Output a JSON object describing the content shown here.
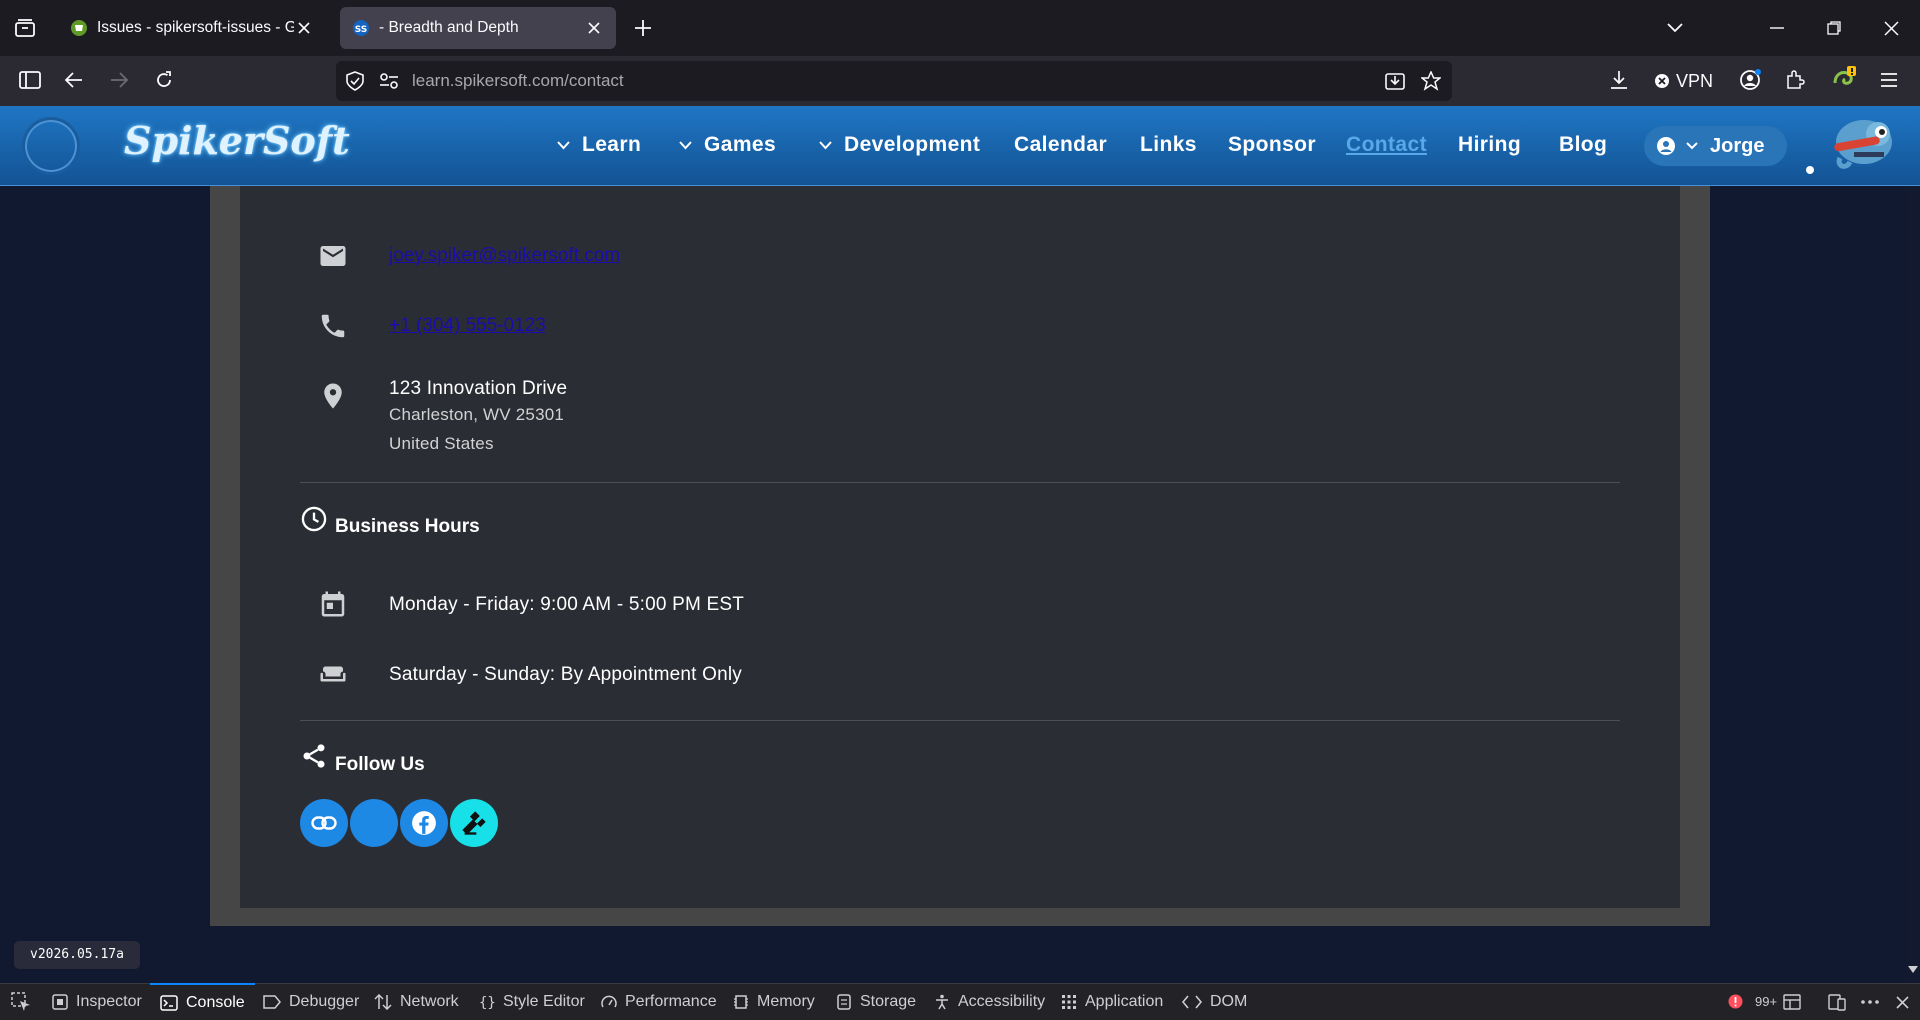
{
  "browser": {
    "tabs": [
      {
        "title": "Issues - spikersoft-issues - Gitea",
        "active": false
      },
      {
        "title": "- Breadth and Depth",
        "active": true
      }
    ],
    "url_domain": "learn.spikersoft.com",
    "url_path": "/contact",
    "vpn_label": "VPN"
  },
  "site": {
    "brand": "SpikerSoft",
    "nav": [
      {
        "label": "Learn",
        "dropdown": true
      },
      {
        "label": "Games",
        "dropdown": true
      },
      {
        "label": "Development",
        "dropdown": true
      },
      {
        "label": "Calendar",
        "dropdown": false
      },
      {
        "label": "Links",
        "dropdown": false
      },
      {
        "label": "Sponsor",
        "dropdown": false
      },
      {
        "label": "Contact",
        "dropdown": false,
        "current": true
      },
      {
        "label": "Hiring",
        "dropdown": false
      },
      {
        "label": "Blog",
        "dropdown": false
      }
    ],
    "user": "Jorge"
  },
  "contact": {
    "email": "joey.spiker@spikersoft.com",
    "phone": "+1 (304) 555-0123",
    "address_line1": "123 Innovation Drive",
    "address_line2": "Charleston, WV 25301",
    "address_line3": "United States"
  },
  "hours": {
    "title": "Business Hours",
    "weekday": "Monday - Friday: 9:00 AM - 5:00 PM EST",
    "weekend": "Saturday - Sunday: By Appointment Only"
  },
  "follow": {
    "title": "Follow Us",
    "buttons": [
      {
        "icon": "link-icon",
        "color": "#1e88e5"
      },
      {
        "icon": "blank-icon",
        "color": "#1e88e5"
      },
      {
        "icon": "facebook-icon",
        "color": "#1e88e5"
      },
      {
        "icon": "gavel-icon",
        "color": "#18e0e8"
      }
    ]
  },
  "version": "v2026.05.17a",
  "devtools": {
    "tabs": [
      "Inspector",
      "Console",
      "Debugger",
      "Network",
      "Style Editor",
      "Performance",
      "Memory",
      "Storage",
      "Accessibility",
      "Application",
      "DOM"
    ],
    "selected": "Console",
    "error_count": "99+"
  },
  "colors": {
    "header_blue": "#1a6ab3",
    "link": "#1a0dab",
    "card": "#2b2d35",
    "page_bg": "#111931"
  }
}
